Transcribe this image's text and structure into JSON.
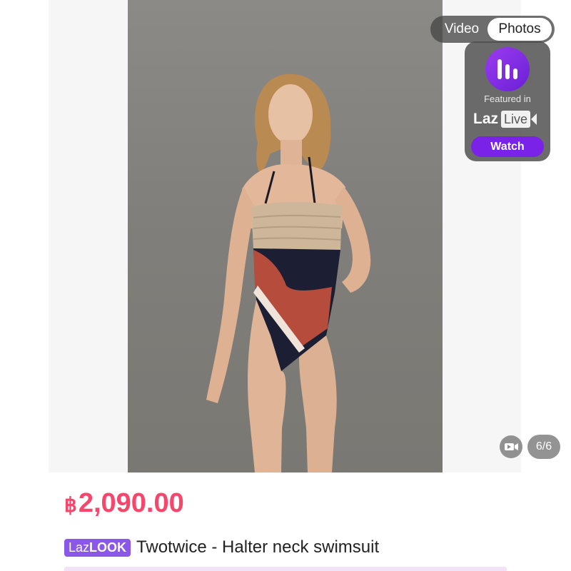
{
  "media_toggle": {
    "video_label": "Video",
    "photos_label": "Photos",
    "selected": "Photos"
  },
  "live_card": {
    "featured_text": "Featured in",
    "brand_laz": "Laz",
    "brand_live": "Live",
    "watch_label": "Watch"
  },
  "gallery": {
    "counter": "6/6",
    "video_icon": "video-camera-icon"
  },
  "product": {
    "currency": "฿",
    "price": "2,090.00",
    "badge_laz": "Laz",
    "badge_look": "LOOK",
    "title": "Twotwice - Halter neck swimsuit"
  },
  "colors": {
    "price": "#f5476b",
    "badge": "#8a57e8",
    "watch_button": "#7a22e8"
  }
}
